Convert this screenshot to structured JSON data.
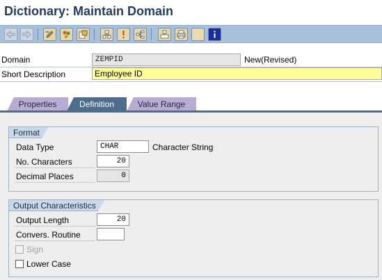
{
  "title": "Dictionary: Maintain Domain",
  "toolbar": {
    "buttons": [
      "back-icon",
      "forward-icon",
      "edit-icon",
      "display-change-icon",
      "activate-icon",
      "where-used-icon",
      "info-icon",
      "hierarchy-icon",
      "object-list-icon",
      "print-icon",
      "blank-icon",
      "help-icon"
    ]
  },
  "header": {
    "domain_label": "Domain",
    "domain_value": "ZEMPID",
    "status": "New(Revised)",
    "short_desc_label": "Short Description",
    "short_desc_value": "Employee ID"
  },
  "tabs": [
    {
      "label": "Properties",
      "active": false
    },
    {
      "label": "Definition",
      "active": true
    },
    {
      "label": "Value Range",
      "active": false
    }
  ],
  "format": {
    "title": "Format",
    "data_type_label": "Data Type",
    "data_type_value": "CHAR",
    "data_type_desc": "Character String",
    "no_chars_label": "No. Characters",
    "no_chars_value": "20",
    "decimal_label": "Decimal Places",
    "decimal_value": "0"
  },
  "output": {
    "title": "Output Characteristics",
    "output_length_label": "Output Length",
    "output_length_value": "20",
    "convers_label": "Convers. Routine",
    "convers_value": "",
    "sign_label": "Sign",
    "sign_checked": false,
    "lower_case_label": "Lower Case",
    "lower_case_checked": false
  }
}
